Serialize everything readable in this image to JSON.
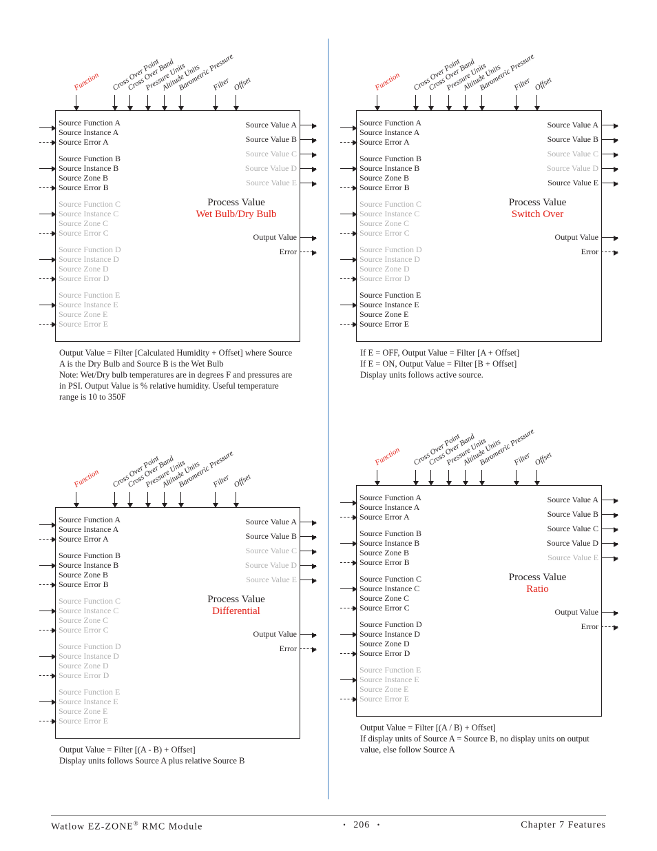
{
  "footer": {
    "product": "Watlow EZ-ZONE",
    "reg": "®",
    "module": " RMC Module",
    "bullet": "•",
    "page_no": "206",
    "chapter": "Chapter 7 Features"
  },
  "param_labels": {
    "function": "Function",
    "cross_over_point": "Cross Over Point",
    "cross_over_band": "Cross Over Band",
    "pressure_units": "Pressure Units",
    "altitude_units": "Altitude Units",
    "barometric_pressure": "Barometric Pressure",
    "filter": "Filter",
    "offset": "Offset"
  },
  "io_labels": {
    "func": "Source Function",
    "inst": "Source Instance",
    "zone": "Source Zone",
    "err": "Source Error",
    "val": "Source Value",
    "out": "Output Value",
    "error": "Error"
  },
  "letters": [
    "A",
    "B",
    "C",
    "D",
    "E"
  ],
  "blocks": {
    "wetbulb": {
      "title1": "Process Value",
      "title2": "Wet Bulb/Dry Bulb",
      "active_groups": [
        "A",
        "B"
      ],
      "active_values": [
        "A",
        "B"
      ],
      "active_out_group": "E_partial_none",
      "caption": "Output Value = Filter [Calculated Humidity +  Offset] where Source A is the Dry Bulb and Source B is the Wet Bulb\nNote: Wet/Dry bulb temperatures are in degrees F and pressures are in PSI.  Output Value is % relative humidity.  Useful temperature range is 10 to 350F"
    },
    "switchover": {
      "title1": "Process Value",
      "title2": "Switch Over",
      "active_groups": [
        "A",
        "B",
        "E"
      ],
      "active_values": [
        "A",
        "B",
        "E"
      ],
      "caption": "If E = OFF,  Output Value = Filter [A + Offset]\nIf E = ON, Output Value = Filter [B + Offset]\nDisplay units follows active source."
    },
    "differential": {
      "title1": "Process Value",
      "title2": "Differential",
      "active_groups": [
        "A",
        "B"
      ],
      "active_values": [
        "A",
        "B"
      ],
      "caption": "Output Value = Filter [(A - B) + Offset]\nDisplay units follows Source A plus relative Source B"
    },
    "ratio": {
      "title1": "Process Value",
      "title2": "Ratio",
      "active_groups": [
        "A",
        "B",
        "C",
        "D"
      ],
      "active_values": [
        "A",
        "B",
        "C",
        "D"
      ],
      "caption": "Output Value = Filter [(A / B) + Offset]\nIf display units of Source A = Source B, no display units on output value, else follow Source A"
    }
  }
}
